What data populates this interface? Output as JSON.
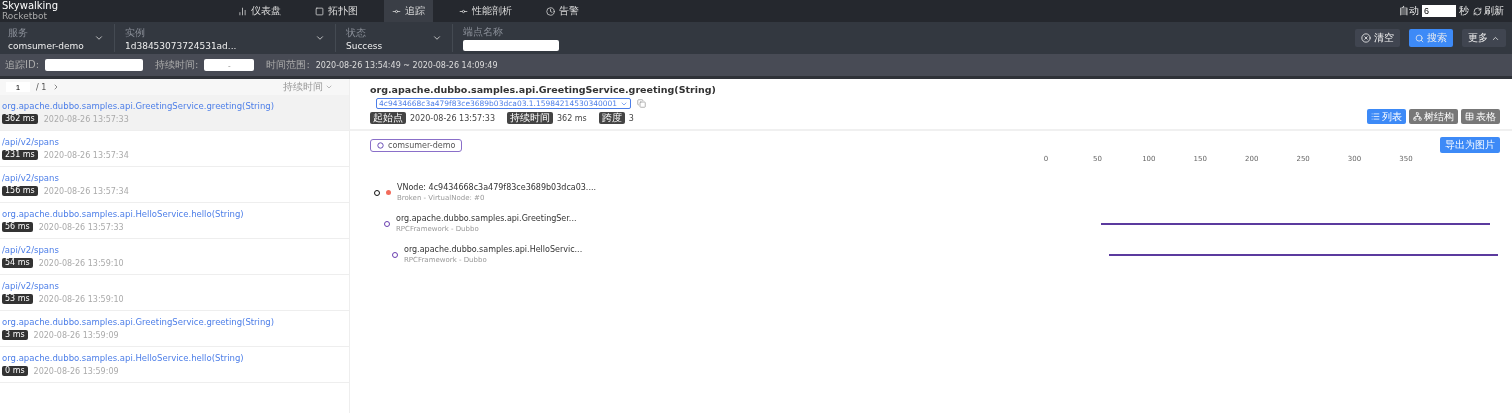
{
  "brand": {
    "name": "Skywalking",
    "sub": "Rocketbot"
  },
  "nav": [
    {
      "label": "仪表盘",
      "selected": false
    },
    {
      "label": "拓扑图",
      "selected": false
    },
    {
      "label": "追踪",
      "selected": true
    },
    {
      "label": "性能剖析",
      "selected": false
    },
    {
      "label": "告警",
      "selected": false
    }
  ],
  "auto": {
    "label": "自动",
    "value": "6",
    "unit": "秒",
    "refresh": "刷新"
  },
  "filters": [
    {
      "kind": "select",
      "label": "服务",
      "value": "comsumer-demo"
    },
    {
      "kind": "select",
      "label": "实例",
      "value": "1d38453073724531ad..."
    },
    {
      "kind": "select",
      "label": "状态",
      "value": "Success"
    },
    {
      "kind": "input",
      "label": "端点名称"
    }
  ],
  "actions": {
    "clear": "清空",
    "search": "搜索",
    "more": "更多"
  },
  "filters2": {
    "trace_id_label": "追踪ID:",
    "duration_label": "持续时间:",
    "duration_value": "-",
    "range_label": "时间范围:",
    "range_value": "2020-08-26 13:54:49 ~ 2020-08-26 14:09:49"
  },
  "pager": {
    "page": "1",
    "total": "/ 1",
    "sort": "持续时间"
  },
  "traces": [
    {
      "name": "org.apache.dubbo.samples.api.GreetingService.greeting(String)",
      "duration": "362 ms",
      "time": "2020-08-26 13:57:33",
      "selected": true
    },
    {
      "name": "/api/v2/spans",
      "duration": "231 ms",
      "time": "2020-08-26 13:57:34",
      "selected": false
    },
    {
      "name": "/api/v2/spans",
      "duration": "156 ms",
      "time": "2020-08-26 13:57:34",
      "selected": false
    },
    {
      "name": "org.apache.dubbo.samples.api.HelloService.hello(String)",
      "duration": "56 ms",
      "time": "2020-08-26 13:57:33",
      "selected": false
    },
    {
      "name": "/api/v2/spans",
      "duration": "54 ms",
      "time": "2020-08-26 13:59:10",
      "selected": false
    },
    {
      "name": "/api/v2/spans",
      "duration": "53 ms",
      "time": "2020-08-26 13:59:10",
      "selected": false
    },
    {
      "name": "org.apache.dubbo.samples.api.GreetingService.greeting(String)",
      "duration": "3 ms",
      "time": "2020-08-26 13:59:09",
      "selected": false
    },
    {
      "name": "org.apache.dubbo.samples.api.HelloService.hello(String)",
      "duration": "0 ms",
      "time": "2020-08-26 13:59:09",
      "selected": false
    }
  ],
  "detail": {
    "title": "org.apache.dubbo.samples.api.GreetingService.greeting(String)",
    "trace_id": "4c9434668c3a479f83ce3689b03dca03.1.15984214530340001",
    "meta": [
      {
        "label": "起始点",
        "value": "2020-08-26 13:57:33"
      },
      {
        "label": "持续时间",
        "value": "362 ms"
      },
      {
        "label": "跨度",
        "value": "3"
      }
    ],
    "views": [
      {
        "label": "列表",
        "selected": true
      },
      {
        "label": "树结构",
        "selected": false
      },
      {
        "label": "表格",
        "selected": false
      }
    ],
    "service": "comsumer-demo",
    "export": "导出为图片",
    "ticks": [
      "0",
      "50",
      "100",
      "150",
      "200",
      "250",
      "300",
      "350"
    ],
    "spans": [
      {
        "name": "VNode: 4c9434668c3a479f83ce3689b03dca03....",
        "sub": "Broken - VirtualNode: #0",
        "broken": true,
        "children": [
          {
            "name": "org.apache.dubbo.samples.api.GreetingSer...",
            "sub": "RPCFramework - Dubbo",
            "children": [
              {
                "name": "org.apache.dubbo.samples.api.HelloServic...",
                "sub": "RPCFramework - Dubbo"
              }
            ]
          }
        ]
      }
    ]
  }
}
